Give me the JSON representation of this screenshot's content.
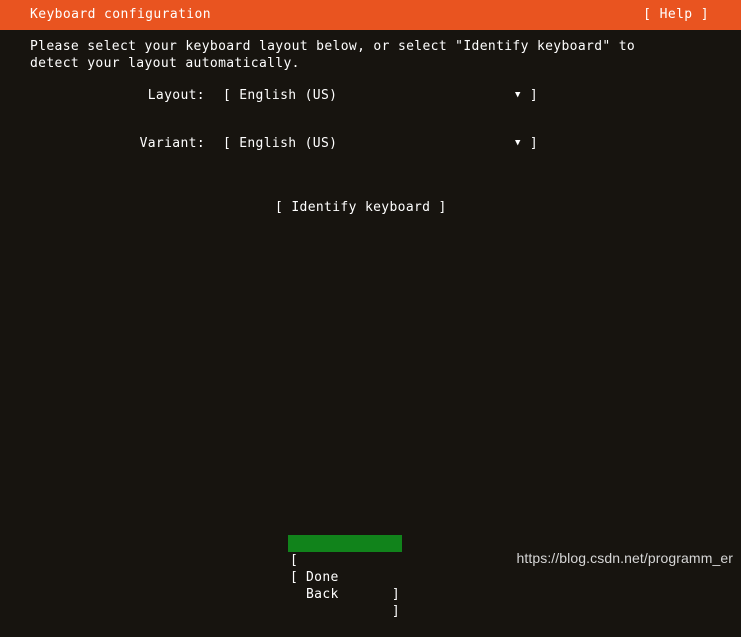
{
  "theme": {
    "header_bg": "#e95420",
    "screen_bg": "#17140f",
    "text_fg": "#ffffff",
    "selected_bg": "#11831b"
  },
  "header": {
    "title": "Keyboard configuration",
    "help_label": "[ Help ]"
  },
  "main": {
    "intro": "Please select your keyboard layout below, or select \"Identify keyboard\" to\ndetect your layout automatically.",
    "fields": [
      {
        "label": "Layout:",
        "bracket_open": "[",
        "value": "English (US)",
        "caret": "▼",
        "bracket_close": "]"
      },
      {
        "label": "Variant:",
        "bracket_open": "[",
        "value": "English (US)",
        "caret": "▼",
        "bracket_close": "]"
      }
    ],
    "identify_button": "[ Identify keyboard ]"
  },
  "footer": {
    "buttons": [
      {
        "bracket_open": "[",
        "label": "Done",
        "bracket_close": "]",
        "selected": true
      },
      {
        "bracket_open": "[",
        "label": "Back",
        "bracket_close": "]",
        "selected": false
      }
    ]
  },
  "watermark": "https://blog.csdn.net/programm_er"
}
